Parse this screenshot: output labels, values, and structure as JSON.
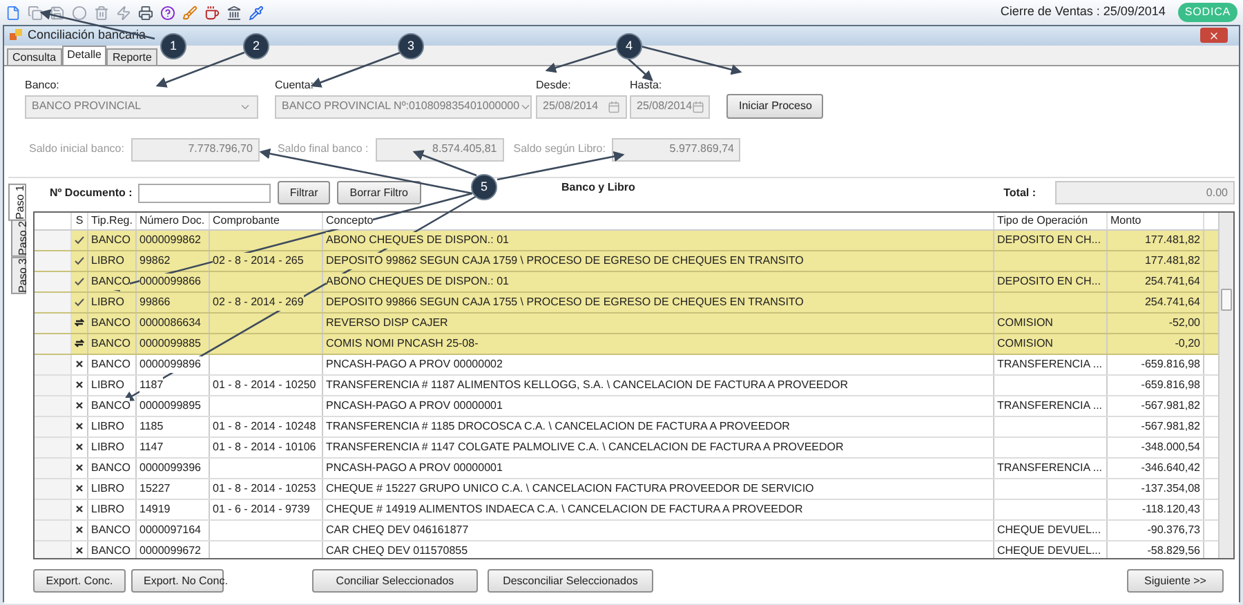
{
  "top_bar": {
    "closing": "Cierre de Ventas : 25/09/2014",
    "logo": "SODICA"
  },
  "window": {
    "title": "Conciliación bancaria"
  },
  "tabs": [
    {
      "label": "Consulta",
      "selected": false
    },
    {
      "label": "Detalle",
      "selected": true
    },
    {
      "label": "Reporte",
      "selected": false
    }
  ],
  "form": {
    "banco_label": "Banco:",
    "banco": "BANCO PROVINCIAL",
    "cuenta_label": "Cuenta:",
    "cuenta": "BANCO PROVINCIAL Nº:010809835401000000",
    "desde_label": "Desde:",
    "desde": "25/08/2014",
    "hasta_label": "Hasta:",
    "hasta": "25/08/2014",
    "start_button": "Iniciar Proceso",
    "saldo_inicial_label": "Saldo inicial banco:",
    "saldo_inicial": "7.778.796,70",
    "saldo_final_label": "Saldo final banco :",
    "saldo_final": "8.574.405,81",
    "saldo_libro_label": "Saldo según Libro:",
    "saldo_libro": "5.977.869,74"
  },
  "steps": [
    {
      "label": "Paso 1",
      "selected": true
    },
    {
      "label": "Paso 2",
      "selected": false
    },
    {
      "label": "Paso 3",
      "selected": false
    }
  ],
  "filter": {
    "label": "Nº Documento :",
    "filter_button": "Filtrar",
    "clear_button": "Borrar Filtro",
    "title": "Banco y Libro",
    "total_label": "Total :",
    "total": "0.00"
  },
  "table": {
    "status_column": "S",
    "columns": [
      "Tip.Reg.",
      "Número Doc.",
      "Comprobante",
      "Concepto",
      "Tipo de Operación",
      "Monto"
    ],
    "rows": [
      {
        "kind": "check",
        "matched": true,
        "cells": [
          "BANCO",
          "0000099862",
          "",
          "ABONO CHEQUES DE DISPON.: 01",
          "DEPOSITO EN CH...",
          "177.481,82"
        ]
      },
      {
        "kind": "check",
        "matched": true,
        "cells": [
          "LIBRO",
          "99862",
          "02 - 8 - 2014 - 265",
          "DEPOSITO 99862 SEGUN CAJA 1759 \\ PROCESO DE EGRESO DE CHEQUES EN TRANSITO",
          "",
          "177.481,82"
        ]
      },
      {
        "kind": "check",
        "matched": true,
        "cells": [
          "BANCO",
          "0000099866",
          "",
          "ABONO CHEQUES DE DISPON.: 01",
          "DEPOSITO EN CH...",
          "254.741,64"
        ]
      },
      {
        "kind": "check",
        "matched": true,
        "cells": [
          "LIBRO",
          "99866",
          "02 - 8 - 2014 - 269",
          "DEPOSITO 99866 SEGUN CAJA 1755 \\ PROCESO DE EGRESO DE CHEQUES EN TRANSITO",
          "",
          "254.741,64"
        ]
      },
      {
        "kind": "swap",
        "matched": true,
        "cells": [
          "BANCO",
          "0000086634",
          "",
          "REVERSO DISP CAJER",
          "COMISION",
          "-52,00"
        ]
      },
      {
        "kind": "swap",
        "matched": true,
        "cells": [
          "BANCO",
          "0000099885",
          "",
          "COMIS NOMI PNCASH    25-08-",
          "COMISION",
          "-0,20"
        ]
      },
      {
        "kind": "cross",
        "matched": false,
        "cells": [
          "BANCO",
          "0000099896",
          "",
          "PNCASH-PAGO A PROV  00000002",
          "TRANSFERENCIA ...",
          "-659.816,98"
        ]
      },
      {
        "kind": "cross",
        "matched": false,
        "cells": [
          "LIBRO",
          "1187",
          "01 - 8 - 2014 - 10250",
          "TRANSFERENCIA # 1187 ALIMENTOS KELLOGG, S.A. \\ CANCELACION DE FACTURA A PROVEEDOR",
          "",
          "-659.816,98"
        ]
      },
      {
        "kind": "cross",
        "matched": false,
        "cells": [
          "BANCO",
          "0000099895",
          "",
          "PNCASH-PAGO A PROV  00000001",
          "TRANSFERENCIA ...",
          "-567.981,82"
        ]
      },
      {
        "kind": "cross",
        "matched": false,
        "cells": [
          "LIBRO",
          "1185",
          "01 - 8 - 2014 - 10248",
          "TRANSFERENCIA # 1185 DROCOSCA C.A. \\ CANCELACION DE FACTURA A PROVEEDOR",
          "",
          "-567.981,82"
        ]
      },
      {
        "kind": "cross",
        "matched": false,
        "cells": [
          "LIBRO",
          "1147",
          "01 - 8 - 2014 - 10106",
          "TRANSFERENCIA # 1147 COLGATE PALMOLIVE C.A. \\ CANCELACION DE FACTURA A PROVEEDOR",
          "",
          "-348.000,54"
        ]
      },
      {
        "kind": "cross",
        "matched": false,
        "cells": [
          "BANCO",
          "0000099396",
          "",
          "PNCASH-PAGO A PROV  00000001",
          "TRANSFERENCIA ...",
          "-346.640,42"
        ]
      },
      {
        "kind": "cross",
        "matched": false,
        "cells": [
          "LIBRO",
          "15227",
          "01 - 8 - 2014 - 10253",
          "CHEQUE # 15227 GRUPO UNICO C.A. \\ CANCELACION FACTURA PROVEEDOR DE SERVICIO",
          "",
          "-137.354,08"
        ]
      },
      {
        "kind": "cross",
        "matched": false,
        "cells": [
          "LIBRO",
          "14919",
          "01 - 6 - 2014 - 9739",
          "CHEQUE # 14919 ALIMENTOS INDAECA C.A. \\ CANCELACION DE FACTURA A PROVEEDOR",
          "",
          "-118.120,43"
        ]
      },
      {
        "kind": "cross",
        "matched": false,
        "cells": [
          "BANCO",
          "0000097164",
          "",
          "CAR CHEQ DEV    046161877",
          "CHEQUE DEVUEL...",
          "-90.376,73"
        ]
      },
      {
        "kind": "cross",
        "matched": false,
        "cells": [
          "BANCO",
          "0000099672",
          "",
          "CAR CHEQ DEV    011570855",
          "CHEQUE DEVUEL...",
          "-58.829,56"
        ]
      }
    ]
  },
  "buttons": [
    "Export. Conc.",
    "Export. No Conc.",
    "Conciliar Seleccionados",
    "Desconciliar Seleccionados",
    "Siguiente >>"
  ],
  "callouts": [
    "1",
    "2",
    "3",
    "4",
    "5"
  ]
}
